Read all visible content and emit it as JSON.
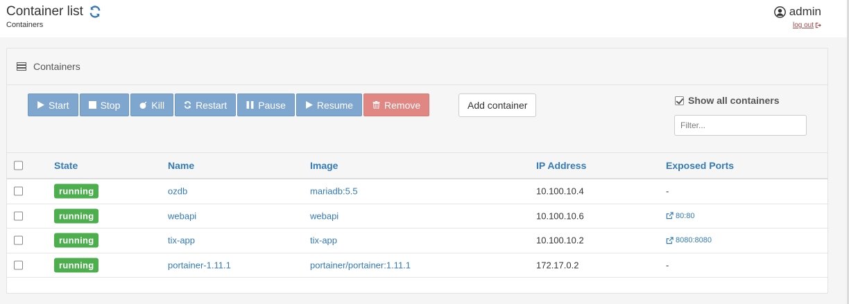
{
  "header": {
    "title": "Container list",
    "breadcrumb": "Containers",
    "username": "admin",
    "logout_label": "log out"
  },
  "widget": {
    "title": "Containers"
  },
  "toolbar": {
    "buttons": [
      {
        "label": "Start",
        "icon": "play-icon"
      },
      {
        "label": "Stop",
        "icon": "stop-icon"
      },
      {
        "label": "Kill",
        "icon": "bomb-icon"
      },
      {
        "label": "Restart",
        "icon": "refresh-icon"
      },
      {
        "label": "Pause",
        "icon": "pause-icon"
      },
      {
        "label": "Resume",
        "icon": "play-icon"
      },
      {
        "label": "Remove",
        "icon": "trash-icon"
      }
    ],
    "add_label": "Add container",
    "show_all_label": "Show all containers",
    "show_all_checked": true,
    "filter_placeholder": "Filter..."
  },
  "table": {
    "columns": [
      "State",
      "Name",
      "Image",
      "IP Address",
      "Exposed Ports"
    ],
    "rows": [
      {
        "state": "running",
        "name": "ozdb",
        "image": "mariadb:5.5",
        "ip": "10.100.10.4",
        "ports": "-"
      },
      {
        "state": "running",
        "name": "webapi",
        "image": "webapi",
        "ip": "10.100.10.6",
        "ports": "80:80"
      },
      {
        "state": "running",
        "name": "tix-app",
        "image": "tix-app",
        "ip": "10.100.10.2",
        "ports": "8080:8080"
      },
      {
        "state": "running",
        "name": "portainer-1.11.1",
        "image": "portainer/portainer:1.11.1",
        "ip": "172.17.0.2",
        "ports": "-"
      }
    ]
  },
  "colors": {
    "accent": "#337ab7",
    "running": "#4cae4c",
    "primary_button": "#7ea6cf",
    "danger_button": "#e08683"
  }
}
